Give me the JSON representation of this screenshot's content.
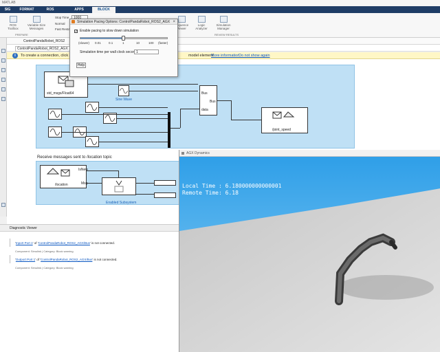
{
  "window": {
    "title": "MATLAB"
  },
  "tabs": [
    {
      "label": "SIG"
    },
    {
      "label": "FORMAT"
    },
    {
      "label": "ROS"
    },
    {
      "label": "APPS"
    },
    {
      "label": "BLOCK",
      "active": true
    }
  ],
  "ribbon": {
    "buttons": [
      {
        "label": "ROS Toolbox"
      },
      {
        "label": "Variable Size Messages"
      },
      {
        "label": "Sequence Viewer"
      },
      {
        "label": "Logic Analyzer"
      },
      {
        "label": "Simulation Manager"
      }
    ],
    "stop_time_label": "Stop Time",
    "stop_time_value": "1000",
    "normal_label": "Normal",
    "fast_restart_label": "Fast Restart",
    "groups": {
      "prepare": "PREPARE",
      "review": "REVIEW RESULTS"
    }
  },
  "address": {
    "path": "ControlPandaRobot_ROS2",
    "model": "ControlPandaRobot_ROS2_AGX"
  },
  "infobar": {
    "text": "To create a connection, click a",
    "tail": "model element.",
    "link_more": "More information.",
    "link_hide": "Do not show again"
  },
  "dialog": {
    "title": "Simulation Pacing Options: ControlPandaRobot_ROS2_AGX",
    "checkbox_label": "Enable pacing to slow down simulation",
    "checked": true,
    "slider_ticks": [
      "(slower)",
      "0.01",
      "0.1",
      "1",
      "10",
      "100",
      "(faster)"
    ],
    "slider_value": "1",
    "rate_label": "Simulation time per wall clock second",
    "rate_value": "1",
    "help_label": "Help"
  },
  "model": {
    "blocks": {
      "std_msgs_float64": "std_msgs/Float64",
      "sine_wave": "Sine Wave",
      "bus_in": "Bus",
      "bus_label": "Bus",
      "data_label": "data",
      "joint_speed": "/joint_speed",
      "subscribe_title": "Receive messages sent to /location topic",
      "location": "/location",
      "is_new": "IsNew",
      "msg": "Msg",
      "enabled_subsystem": "Enabled Subsystem"
    }
  },
  "diagnostics": {
    "title": "Diagnostic Viewer",
    "messages": [
      {
        "prefix": "'",
        "link": "Inport Port 1",
        "mid": "' of '",
        "link2": "ControlPandaRobot_ROS2_AGX/Bus",
        "suffix": "' is not connected.",
        "sub": "Component: Simulink | Category: Block warning"
      },
      {
        "prefix": "'",
        "link": "Outport Port 1",
        "mid": "' of '",
        "link2": "ControlPandaRobot_ROS2_AGX/Bus",
        "suffix": "' is not connected.",
        "sub": "Component: Simulink | Category: Block warning"
      }
    ]
  },
  "viewer": {
    "title": "AGX Dynamics",
    "local_time": "Local Time : 6.180000000000001",
    "remote_time": "Remote Time: 6.18",
    "colors": {
      "sky": "#2f9fe8",
      "ground": "#cfcfcf"
    }
  }
}
